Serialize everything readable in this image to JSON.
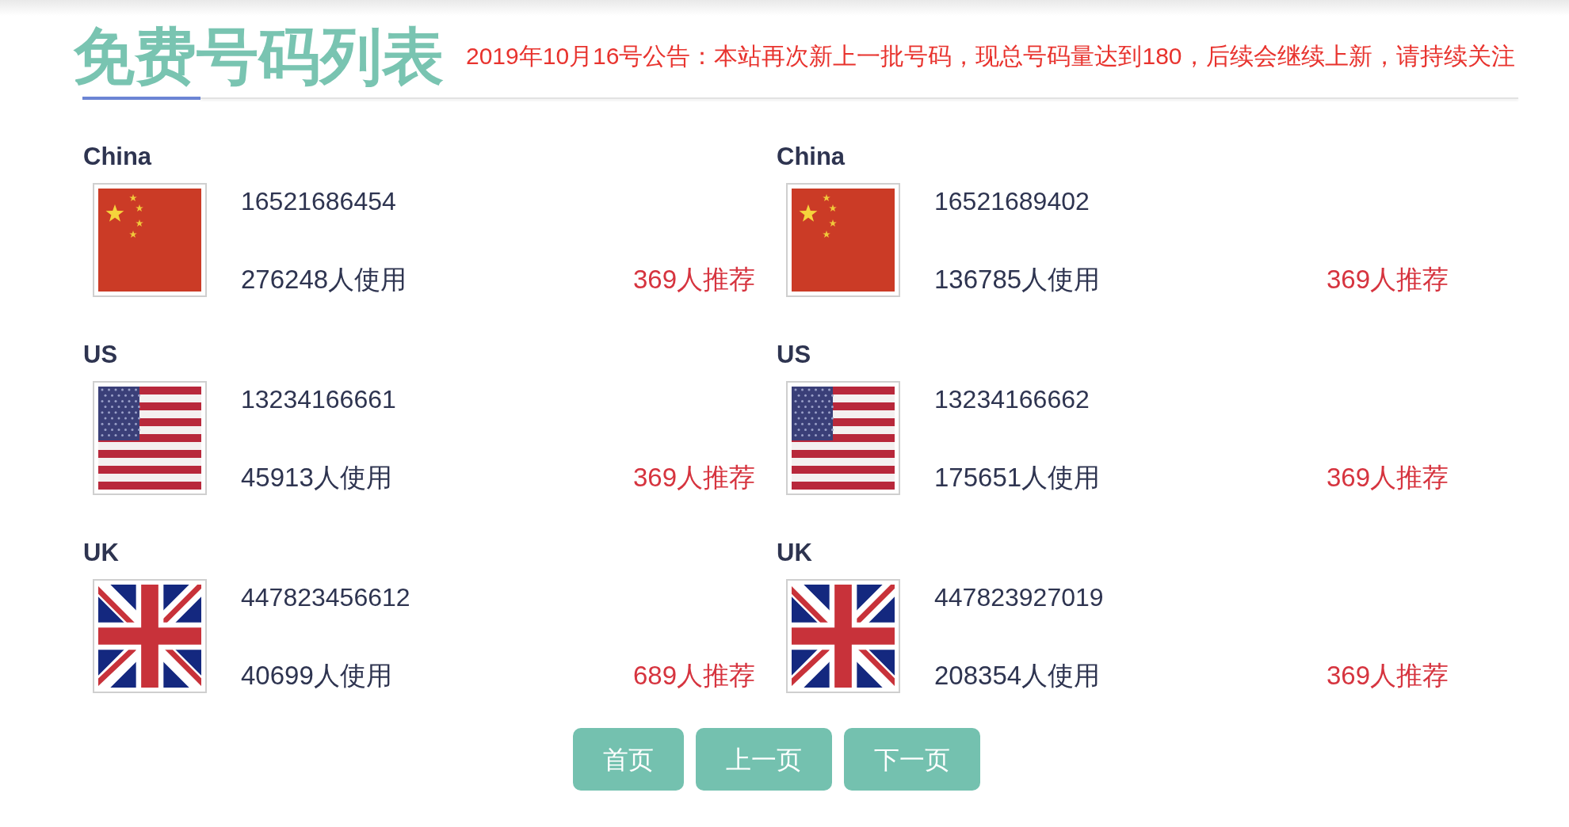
{
  "header": {
    "title": "免费号码列表",
    "notice": "2019年10月16号公告：本站再次新上一批号码，现总号码量达到180，后续会继续上新，请持续关注"
  },
  "numbers": [
    {
      "country": "China",
      "kind": "china",
      "number": "16521686454",
      "usage": "276248人使用",
      "recommend": "369人推荐"
    },
    {
      "country": "China",
      "kind": "china",
      "number": "16521689402",
      "usage": "136785人使用",
      "recommend": "369人推荐"
    },
    {
      "country": "US",
      "kind": "us",
      "number": "13234166661",
      "usage": "45913人使用",
      "recommend": "369人推荐"
    },
    {
      "country": "US",
      "kind": "us",
      "number": "13234166662",
      "usage": "175651人使用",
      "recommend": "369人推荐"
    },
    {
      "country": "UK",
      "kind": "uk",
      "number": "447823456612",
      "usage": "40699人使用",
      "recommend": "689人推荐"
    },
    {
      "country": "UK",
      "kind": "uk",
      "number": "447823927019",
      "usage": "208354人使用",
      "recommend": "369人推荐"
    }
  ],
  "pagination": [
    "首页",
    "上一页",
    "下一页"
  ]
}
